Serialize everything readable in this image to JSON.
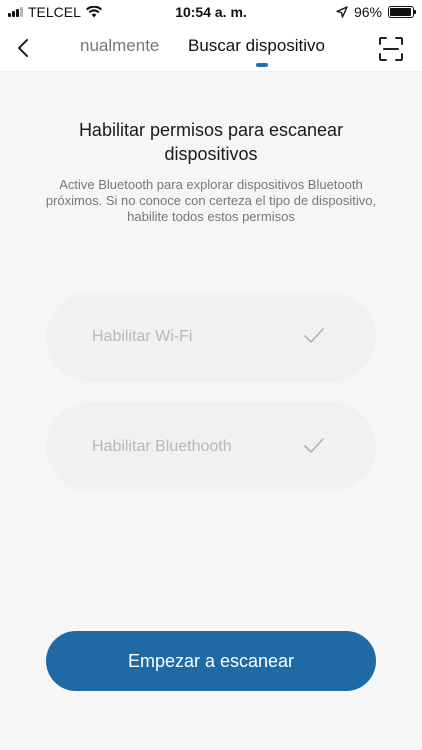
{
  "status_bar": {
    "carrier": "TELCEL",
    "time": "10:54 a. m.",
    "battery_percent": "96%",
    "battery_level": 0.96,
    "signal_bars": 3,
    "icons": [
      "signal-icon",
      "wifi-icon",
      "location-arrow-icon",
      "battery-icon"
    ]
  },
  "nav": {
    "tabs": [
      {
        "label": "nualmente",
        "active": false
      },
      {
        "label": "Buscar dispositivo",
        "active": true
      }
    ],
    "accent": "#1f6fb5",
    "icons": {
      "back": "chevron-left-icon",
      "scan": "scan-frame-icon"
    }
  },
  "main": {
    "title": "Habilitar permisos para escanear dispositivos",
    "description": "Active Bluetooth para explorar dispositivos Bluetooth próximos. Si no conoce con certeza el tipo de dispositivo, habilite todos estos permisos",
    "permissions": [
      {
        "label": "Habilitar Wi-Fi",
        "checked": true
      },
      {
        "label": "Habilitar Bluethooth",
        "checked": true
      }
    ],
    "start_button": "Empezar a escanear",
    "button_color": "#1f6aa5"
  }
}
